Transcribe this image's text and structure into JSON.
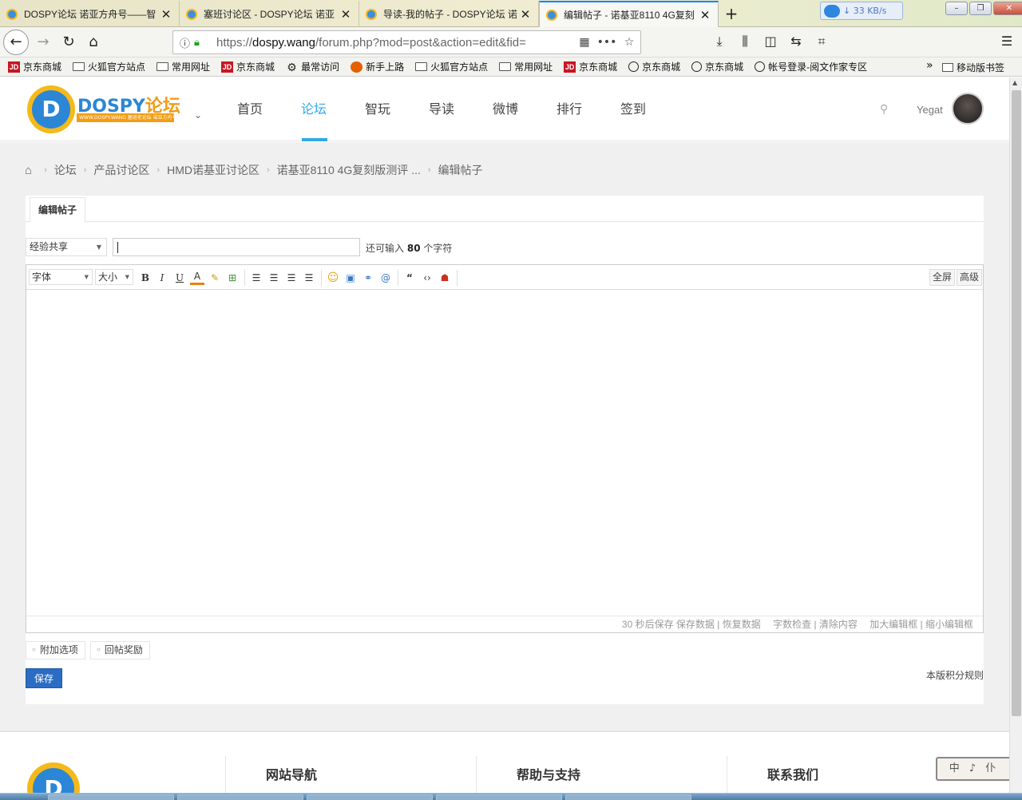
{
  "browser": {
    "tabs": [
      {
        "title": "DOSPY论坛 诺亚方舟号——智"
      },
      {
        "title": "塞班讨论区 - DOSPY论坛 诺亚"
      },
      {
        "title": "导读-我的帖子 - DOSPY论坛 诺"
      },
      {
        "title": "编辑帖子 - 诺基亚8110 4G复刻"
      }
    ],
    "new_tab_label": "+",
    "download_speed": "33 KB/s",
    "url_prefix": "https://",
    "url_host": "dospy.wang",
    "url_path": "/forum.php?mod=post&action=edit&fid=",
    "bookmarks": [
      {
        "label": "京东商城",
        "icon": "jd-icon"
      },
      {
        "label": "火狐官方站点",
        "icon": "folder-icon"
      },
      {
        "label": "常用网址",
        "icon": "folder-icon"
      },
      {
        "label": "京东商城",
        "icon": "jd-icon"
      },
      {
        "label": "最常访问",
        "icon": "gear-icon"
      },
      {
        "label": "新手上路",
        "icon": "firefox-icon"
      },
      {
        "label": "火狐官方站点",
        "icon": "folder-icon"
      },
      {
        "label": "常用网址",
        "icon": "folder-icon"
      },
      {
        "label": "京东商城",
        "icon": "jd-icon"
      },
      {
        "label": "京东商城",
        "icon": "globe-icon"
      },
      {
        "label": "京东商城",
        "icon": "globe-icon"
      },
      {
        "label": "帐号登录-阅文作家专区",
        "icon": "globe-icon"
      }
    ],
    "mobile_bookmarks": "移动版书签"
  },
  "site": {
    "logo_letter": "D",
    "logo_name": "DOSPY",
    "logo_name_cn": "论坛",
    "logo_sub": "WWW.DOSPY.WANG 塞班老论坛 诺亚方舟号",
    "nav": [
      "首页",
      "论坛",
      "智玩",
      "导读",
      "微博",
      "排行",
      "签到"
    ],
    "active_nav": "论坛",
    "username": "Yegat"
  },
  "breadcrumb": [
    "论坛",
    "产品讨论区",
    "HMD诺基亚讨论区",
    "诺基亚8110 4G复刻版测评 ...",
    "编辑帖子"
  ],
  "form": {
    "tab_label": "编辑帖子",
    "type_select": "经验共享",
    "title_value": "",
    "char_left_prefix": "还可输入",
    "char_left_count": "80",
    "char_left_suffix": "个字符",
    "toolbar": {
      "font_select": "字体",
      "size_select": "大小",
      "buttons": [
        "B",
        "I",
        "U",
        "A"
      ],
      "fullscreen": "全屏",
      "advanced": "高级"
    },
    "status": {
      "autosave": "30 秒后保存 保存数据 | 恢复数据",
      "wordcheck": "字数检查 | 清除内容",
      "resize": "加大编辑框 | 缩小编辑框"
    },
    "options": [
      "附加选项",
      "回帖奖励"
    ],
    "save_label": "保存",
    "rules_link": "本版积分规则"
  },
  "footer": {
    "columns": [
      "网站导航",
      "帮助与支持",
      "联系我们"
    ]
  },
  "ime": "中 ♪ 仆"
}
